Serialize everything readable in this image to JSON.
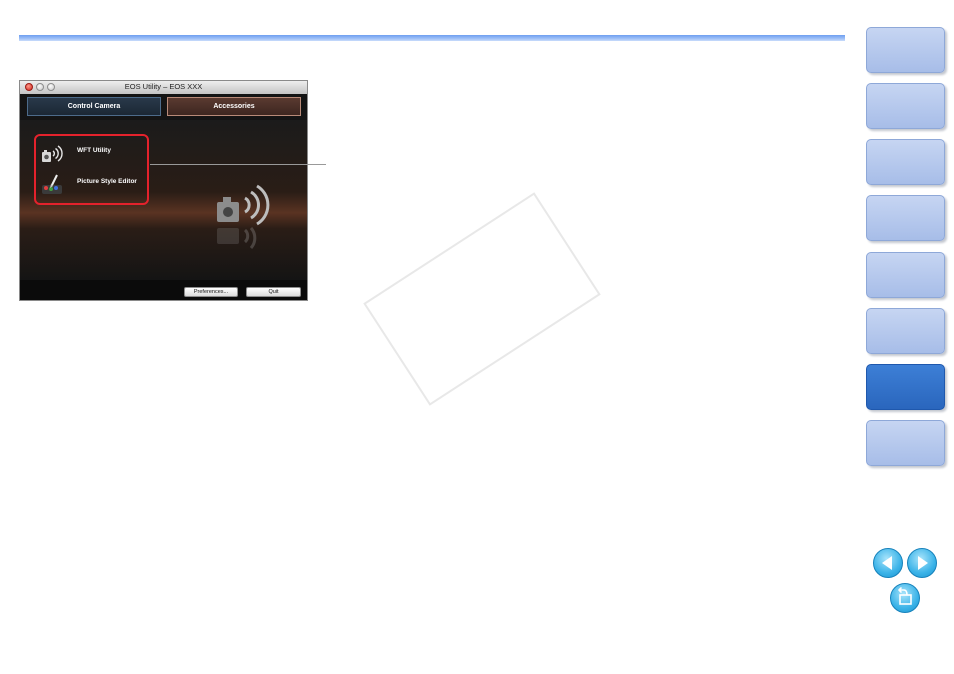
{
  "window": {
    "title": "EOS Utility – EOS XXX",
    "tabs": [
      {
        "label": "Control Camera"
      },
      {
        "label": "Accessories"
      }
    ],
    "apps": [
      {
        "label": "WFT Utility",
        "icon": "wireless-camera-icon"
      },
      {
        "label": "Picture Style Editor",
        "icon": "picture-style-editor-icon"
      }
    ],
    "buttons": {
      "preferences": "Preferences...",
      "quit": "Quit"
    }
  },
  "side_nav": {
    "tabs": [
      {
        "name": "nav-tab-1",
        "active": false
      },
      {
        "name": "nav-tab-2",
        "active": false
      },
      {
        "name": "nav-tab-3",
        "active": false
      },
      {
        "name": "nav-tab-4",
        "active": false
      },
      {
        "name": "nav-tab-5",
        "active": false
      },
      {
        "name": "nav-tab-6",
        "active": false
      },
      {
        "name": "nav-tab-7",
        "active": true
      },
      {
        "name": "nav-tab-8",
        "active": false
      }
    ],
    "arrows": [
      "previous-page-icon",
      "next-page-icon",
      "return-icon"
    ]
  },
  "colors": {
    "accent": "#6d9ef0",
    "highlight_box": "#e4222c",
    "nav_active": "#2a66bd",
    "nav_inactive": "#b4c7ec"
  }
}
